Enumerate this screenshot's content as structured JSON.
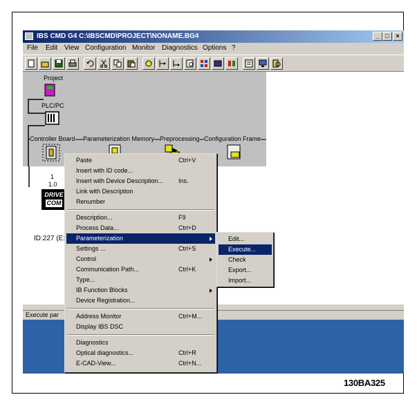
{
  "window": {
    "title": "IBS CMD G4 C:\\IBSCMD\\PROJECT\\NONAME.BG4",
    "min_label": "_",
    "max_label": "□",
    "close_label": "×"
  },
  "menu": [
    "File",
    "Edit",
    "View",
    "Configuration",
    "Monitor",
    "Diagnostics",
    "Options",
    "?"
  ],
  "toolbar": {
    "icons": [
      "new-icon",
      "open-icon",
      "save-icon",
      "print-icon",
      "undo-icon",
      "cut-icon",
      "copy-icon",
      "paste-icon",
      "settings-icon",
      "insert-before-icon",
      "insert-after-icon",
      "find-icon",
      "network-icon",
      "device-icon",
      "stop-icon",
      "parameter-icon",
      "monitor-icon",
      "diagnostic-icon"
    ]
  },
  "tree": {
    "project": "Project",
    "plc": "PLC/PC",
    "controller": "Controller Board",
    "param_memory": "Parameterization Memory",
    "preprocessing": "Preprocessing",
    "config_frame": "Configuration Frame",
    "node_num": "1",
    "node_addr": "1.0",
    "drive_line1": "DRIVE",
    "drive_line2": "COM",
    "device_id": "ID:227 (E:"
  },
  "status": {
    "text": "Execute par"
  },
  "context_menu": {
    "items": [
      {
        "label": "Paste",
        "shortcut": "Ctrl+V"
      },
      {
        "label": "Insert with ID code...",
        "shortcut": ""
      },
      {
        "label": "Insert with Device Description...",
        "shortcut": "Ins."
      },
      {
        "label": "Link with Description",
        "shortcut": ""
      },
      {
        "label": "Renumber",
        "shortcut": ""
      },
      {
        "label": "Description...",
        "shortcut": "F9"
      },
      {
        "label": "Process Data...",
        "shortcut": "Ctrl+D"
      },
      {
        "label": "Parameterization",
        "shortcut": ""
      },
      {
        "label": "Settings ...",
        "shortcut": "Ctrl+S"
      },
      {
        "label": "Control",
        "shortcut": ""
      },
      {
        "label": "Communication Path...",
        "shortcut": "Ctrl+K"
      },
      {
        "label": "Type...",
        "shortcut": ""
      },
      {
        "label": "IB Function Blocks",
        "shortcut": ""
      },
      {
        "label": "Device Registration...",
        "shortcut": ""
      },
      {
        "label": "Address Monitor",
        "shortcut": "Ctrl+M..."
      },
      {
        "label": "Display IBS DSC",
        "shortcut": ""
      },
      {
        "label": "Diagnostics",
        "shortcut": ""
      },
      {
        "label": "Optical diagnostics...",
        "shortcut": "Ctrl+R"
      },
      {
        "label": "E-CAD-View...",
        "shortcut": "Ctrl+N..."
      }
    ]
  },
  "submenu": {
    "items": [
      "Edit...",
      "Execute...",
      "Check",
      "Export...",
      "Import..."
    ]
  },
  "figure_id": "130BA325",
  "colors": {
    "title_bar": "#0a246a",
    "selection": "#0a246a",
    "desktop": "#2e62a6",
    "face": "#d4d0c8"
  }
}
